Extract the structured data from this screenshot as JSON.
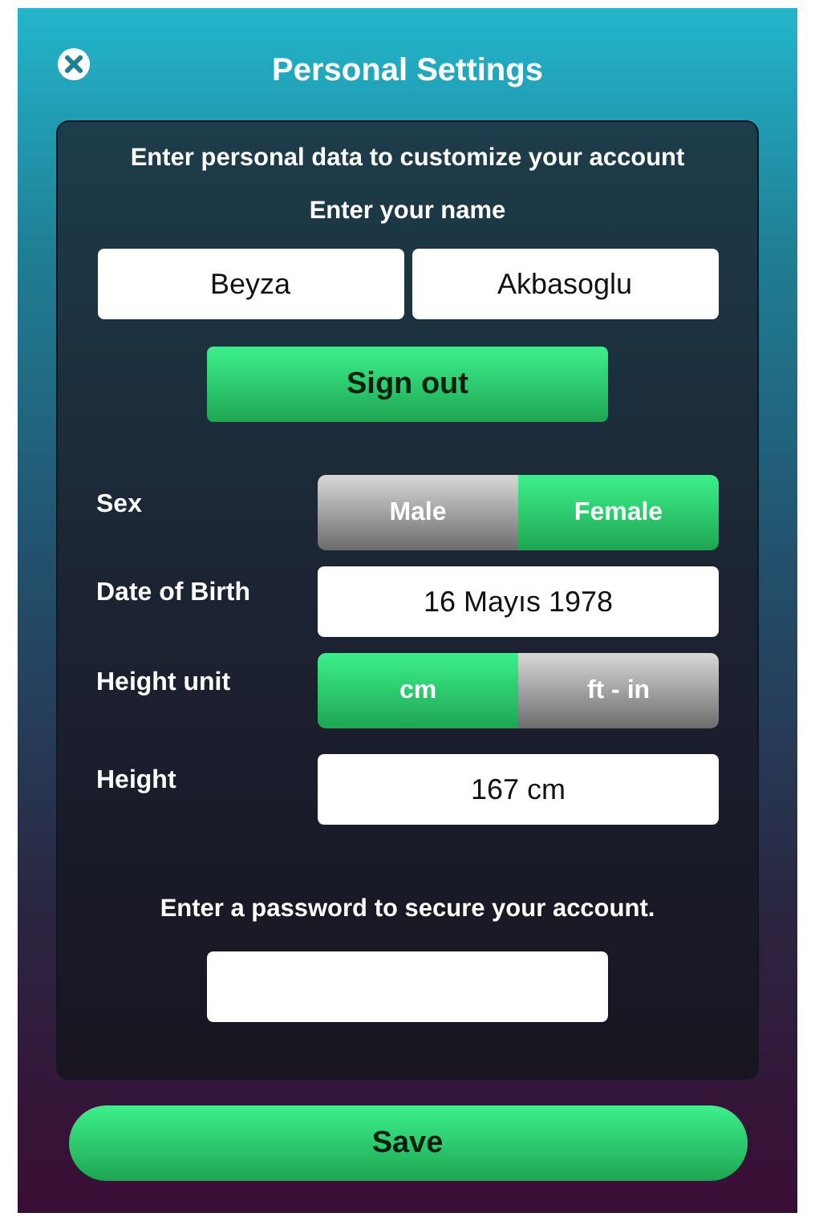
{
  "header": {
    "title": "Personal Settings"
  },
  "intro": "Enter personal data to customize your account",
  "name_prompt": "Enter your name",
  "name_fields": [
    {
      "value": "Beyza"
    },
    {
      "value": "Akbasoglu"
    }
  ],
  "sign_out": "Sign out",
  "rows": [
    {
      "kind": "segmented",
      "label": "Sex",
      "options": [
        {
          "label": "Male",
          "selected": false
        },
        {
          "label": "Female",
          "selected": true
        }
      ]
    },
    {
      "kind": "field",
      "label": "Date of Birth",
      "value": "16 Mayıs 1978"
    },
    {
      "kind": "segmented",
      "label": "Height unit",
      "options": [
        {
          "label": "cm",
          "selected": true
        },
        {
          "label": "ft - in",
          "selected": false
        }
      ]
    },
    {
      "kind": "field",
      "label": "Height",
      "value": "167 cm"
    }
  ],
  "password_prompt": "Enter a password to secure your account.",
  "save": "Save"
}
